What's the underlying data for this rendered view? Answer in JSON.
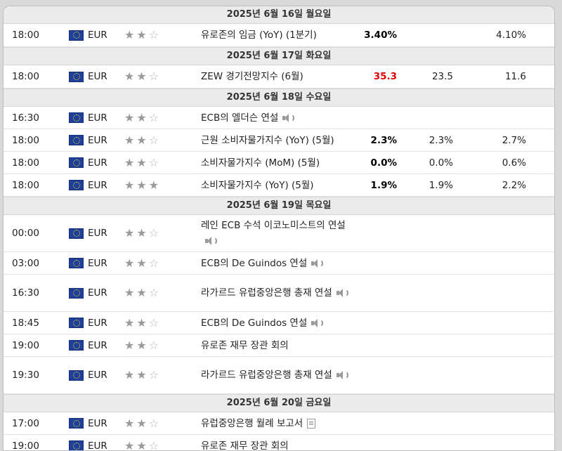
{
  "days": [
    {
      "header": "2025년 6월 16일 월요일",
      "events": [
        {
          "time": "18:00",
          "currency": "EUR",
          "stars": 2,
          "name": "유로존의 임금 (YoY) (1분기)",
          "icon": "",
          "actual": "3.40%",
          "actual_color": "#000000",
          "forecast": "",
          "previous": "4.10%",
          "h": 32
        }
      ]
    },
    {
      "header": "2025년 6월 17일 화요일",
      "events": [
        {
          "time": "18:00",
          "currency": "EUR",
          "stars": 2,
          "name": "ZEW 경기전망지수 (6월)",
          "icon": "",
          "actual": "35.3",
          "actual_color": "#e00000",
          "forecast": "23.5",
          "previous": "11.6",
          "h": 32
        }
      ]
    },
    {
      "header": "2025년 6월 18일 수요일",
      "events": [
        {
          "time": "16:30",
          "currency": "EUR",
          "stars": 2,
          "name": "ECB의 엘더슨 연설",
          "icon": "speaker-icon",
          "actual": "",
          "actual_color": "#000000",
          "forecast": "",
          "previous": "",
          "h": 31
        },
        {
          "time": "18:00",
          "currency": "EUR",
          "stars": 2,
          "name": "근원 소비자물가지수 (YoY) (5월)",
          "icon": "",
          "actual": "2.3%",
          "actual_color": "#000000",
          "forecast": "2.3%",
          "previous": "2.7%",
          "h": 31
        },
        {
          "time": "18:00",
          "currency": "EUR",
          "stars": 2,
          "name": "소비자물가지수 (MoM) (5월)",
          "icon": "",
          "actual": "0.0%",
          "actual_color": "#000000",
          "forecast": "0.0%",
          "previous": "0.6%",
          "h": 31
        },
        {
          "time": "18:00",
          "currency": "EUR",
          "stars": 3,
          "name": "소비자물가지수 (YoY) (5월)",
          "icon": "",
          "actual": "1.9%",
          "actual_color": "#000000",
          "forecast": "1.9%",
          "previous": "2.2%",
          "h": 31
        }
      ]
    },
    {
      "header": "2025년 6월 19일 목요일",
      "events": [
        {
          "time": "00:00",
          "currency": "EUR",
          "stars": 2,
          "name": "레인 ECB 수석 이코노미스트의 연설",
          "icon": "speaker-icon",
          "actual": "",
          "actual_color": "#000000",
          "forecast": "",
          "previous": "",
          "h": 52
        },
        {
          "time": "03:00",
          "currency": "EUR",
          "stars": 2,
          "name": "ECB의 De Guindos 연설",
          "icon": "speaker-icon",
          "actual": "",
          "actual_color": "#000000",
          "forecast": "",
          "previous": "",
          "h": 31
        },
        {
          "time": "16:30",
          "currency": "EUR",
          "stars": 2,
          "name": "라가르드 유럽중앙은행 총재 연설",
          "icon": "speaker-icon",
          "actual": "",
          "actual_color": "#000000",
          "forecast": "",
          "previous": "",
          "h": 52
        },
        {
          "time": "18:45",
          "currency": "EUR",
          "stars": 2,
          "name": "ECB의 De Guindos 연설",
          "icon": "speaker-icon",
          "actual": "",
          "actual_color": "#000000",
          "forecast": "",
          "previous": "",
          "h": 31
        },
        {
          "time": "19:00",
          "currency": "EUR",
          "stars": 2,
          "name": "유로존 재무 장관 회의",
          "icon": "",
          "actual": "",
          "actual_color": "#000000",
          "forecast": "",
          "previous": "",
          "h": 31
        },
        {
          "time": "19:30",
          "currency": "EUR",
          "stars": 2,
          "name": "라가르드 유럽중앙은행 총재 연설",
          "icon": "speaker-icon",
          "actual": "",
          "actual_color": "#000000",
          "forecast": "",
          "previous": "",
          "h": 52
        }
      ]
    },
    {
      "header": "2025년 6월 20일 금요일",
      "events": [
        {
          "time": "17:00",
          "currency": "EUR",
          "stars": 2,
          "name": "유럽중앙은행 월례 보고서",
          "icon": "document-icon",
          "actual": "",
          "actual_color": "#000000",
          "forecast": "",
          "previous": "",
          "h": 31
        },
        {
          "time": "19:00",
          "currency": "EUR",
          "stars": 2,
          "name": "유로존 재무 장관 회의",
          "icon": "",
          "actual": "",
          "actual_color": "#000000",
          "forecast": "",
          "previous": "",
          "h": 31
        }
      ]
    }
  ]
}
